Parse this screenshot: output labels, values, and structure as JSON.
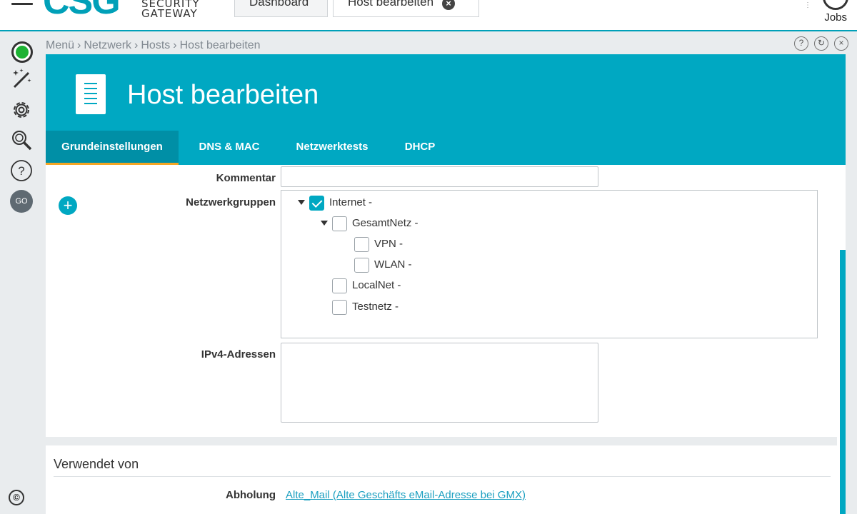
{
  "logo": {
    "mark": "CSG",
    "line1": "SECURITY",
    "line2": "GATEWAY"
  },
  "top_tabs": [
    {
      "label": "Dashboard"
    },
    {
      "label": "Host bearbeiten",
      "closable": true
    }
  ],
  "jobs_label": "Jobs",
  "rail": {
    "go_label": "GO",
    "copyright": "©"
  },
  "breadcrumb": [
    "Menü",
    "Netzwerk",
    "Hosts",
    "Host bearbeiten"
  ],
  "breadcrumb_sep": "›",
  "page_title": "Host bearbeiten",
  "tabs": [
    {
      "label": "Grundeinstellungen",
      "active": true
    },
    {
      "label": "DNS & MAC"
    },
    {
      "label": "Netzwerktests"
    },
    {
      "label": "DHCP"
    }
  ],
  "form": {
    "kommentar_label": "Kommentar",
    "kommentar_value": "",
    "netzwerkgruppen_label": "Netzwerkgruppen",
    "groups": [
      {
        "label": "Internet -",
        "checked": true,
        "expanded": true
      },
      {
        "label": "GesamtNetz -",
        "checked": false,
        "expanded": true
      },
      {
        "label": "VPN -",
        "checked": false
      },
      {
        "label": "WLAN -",
        "checked": false
      },
      {
        "label": "LocalNet -",
        "checked": false
      },
      {
        "label": "Testnetz -",
        "checked": false
      }
    ],
    "ipv4_label": "IPv4-Adressen",
    "ipv4_value": ""
  },
  "used_by": {
    "title": "Verwendet von",
    "label": "Abholung",
    "link": "Alte_Mail (Alte Geschäfts eMail-Adresse bei GMX)"
  },
  "colors": {
    "accent": "#00a8c2",
    "tab_underline": "#f5a623",
    "status_ok": "#1db233"
  }
}
